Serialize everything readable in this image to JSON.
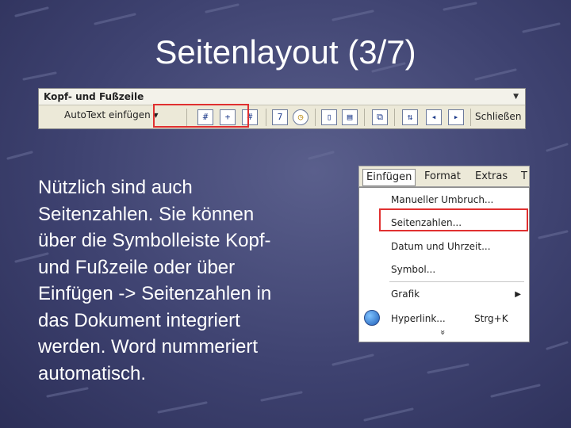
{
  "slide": {
    "title": "Seitenlayout (3/7)",
    "body": "Nützlich sind auch\nSeitenzahlen. Sie können\nüber die Symbolleiste Kopf-\nund Fußzeile oder über\nEinfügen -> Seitenzahlen in\ndas Dokument integriert\nwerden. Word nummeriert\nautomatisch."
  },
  "toolbar": {
    "title": "Kopf- und Fußzeile",
    "autotext": "AutoText einfügen ▾",
    "close": "Schließen",
    "buttons": [
      {
        "icon": "page-number-icon",
        "glyph": "#"
      },
      {
        "icon": "page-count-icon",
        "glyph": "+"
      },
      {
        "icon": "format-page-number-icon",
        "glyph": "#"
      },
      {
        "icon": "date-icon",
        "glyph": "7"
      },
      {
        "icon": "time-icon",
        "glyph": "◷"
      },
      {
        "icon": "page-setup-icon",
        "glyph": "▯"
      },
      {
        "icon": "show-hide-text-icon",
        "glyph": "▤"
      },
      {
        "icon": "same-as-previous-icon",
        "glyph": "⧉"
      },
      {
        "icon": "switch-header-footer-icon",
        "glyph": "⇅"
      },
      {
        "icon": "show-previous-icon",
        "glyph": "◂"
      },
      {
        "icon": "show-next-icon",
        "glyph": "▸"
      }
    ]
  },
  "menu": {
    "bar": [
      "Einfügen",
      "Format",
      "Extras",
      "T"
    ],
    "items": [
      {
        "label": "Manueller Umbruch..."
      },
      {
        "label": "Seitenzahlen..."
      },
      {
        "label": "Datum und Uhrzeit..."
      },
      {
        "label": "Symbol..."
      },
      {
        "label": "Grafik"
      },
      {
        "label": "Hyperlink...",
        "shortcut": "Strg+K"
      },
      {
        "label": "»"
      }
    ]
  },
  "colors": {
    "highlight": "#e03030",
    "background": "#3e4270"
  }
}
